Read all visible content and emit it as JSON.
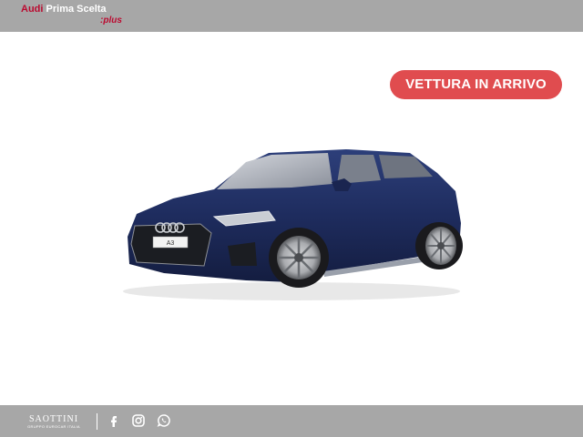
{
  "header": {
    "brand_audi": "Audi",
    "brand_rest": "Prima Scelta",
    "brand_plus": ":plus"
  },
  "badge": {
    "label": "VETTURA IN ARRIVO"
  },
  "vehicle": {
    "plate_text": "A3",
    "color": "#1e2c5e"
  },
  "footer": {
    "dealer_name": "SAOTTINI",
    "dealer_sub": "GRUPPO EUROCAR ITALIA",
    "social_icons": [
      "facebook-icon",
      "instagram-icon",
      "whatsapp-icon"
    ]
  },
  "colors": {
    "bar": "#a7a7a7",
    "badge": "#e04c4f",
    "brand_red": "#bb0a30"
  }
}
